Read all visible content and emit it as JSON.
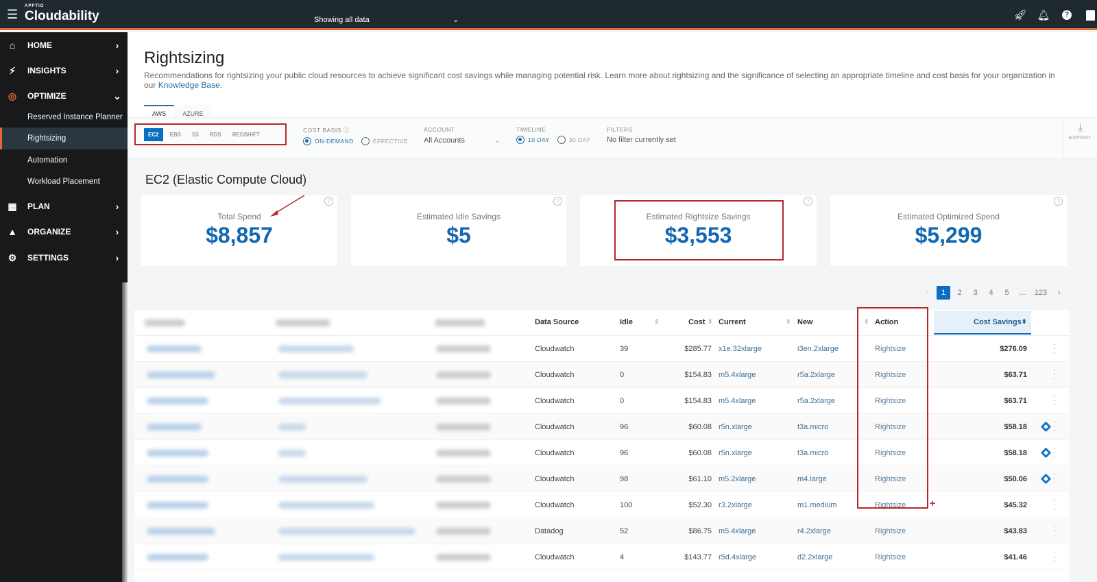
{
  "header": {
    "brand_small": "APPTIO",
    "brand": "Cloudability",
    "scope": "Showing all data",
    "icons": [
      "rocket-icon",
      "bell-icon",
      "help-icon",
      "user-icon"
    ]
  },
  "sidebar": {
    "items": [
      {
        "label": "HOME",
        "icon": "home-icon"
      },
      {
        "label": "INSIGHTS",
        "icon": "bolt-icon"
      },
      {
        "label": "OPTIMIZE",
        "icon": "target-icon",
        "expanded": true
      },
      {
        "label": "PLAN",
        "icon": "calendar-icon"
      },
      {
        "label": "ORGANIZE",
        "icon": "shapes-icon"
      },
      {
        "label": "SETTINGS",
        "icon": "gear-icon"
      }
    ],
    "sub_items": [
      {
        "label": "Reserved Instance Planner"
      },
      {
        "label": "Rightsizing",
        "active": true
      },
      {
        "label": "Automation"
      },
      {
        "label": "Workload Placement"
      }
    ]
  },
  "page": {
    "title": "Rightsizing",
    "description": "Recommendations for rightsizing your public cloud resources to achieve significant cost savings while managing potential risk. Learn more about rightsizing and the significance of selecting an appropriate timeline and cost basis for your organization in our ",
    "link": "Knowledge Base",
    "link_suffix": "."
  },
  "cloud_tabs": [
    "AWS",
    "AZURE"
  ],
  "service_tabs": [
    "EC2",
    "EBS",
    "S3",
    "RDS",
    "REDSHIFT"
  ],
  "filters": {
    "cost_basis_label": "COST BASIS",
    "cost_basis_options": [
      "ON-DEMAND",
      "EFFECTIVE"
    ],
    "account_label": "ACCOUNT",
    "account_value": "All Accounts",
    "timeline_label": "TIMELINE",
    "timeline_options": [
      "10 DAY",
      "30 DAY"
    ],
    "filters_label": "FILTERS",
    "filters_value": "No filter currently set",
    "export_label": "EXPORT"
  },
  "section_title": "EC2 (Elastic Compute Cloud)",
  "cards": [
    {
      "label": "Total Spend",
      "value": "$8,857"
    },
    {
      "label": "Estimated Idle Savings",
      "value": "$5"
    },
    {
      "label": "Estimated Rightsize Savings",
      "value": "$3,553"
    },
    {
      "label": "Estimated Optimized Spend",
      "value": "$5,299"
    }
  ],
  "pagination": {
    "prev": "‹",
    "pages": [
      "1",
      "2",
      "3",
      "4",
      "5",
      "…",
      "123"
    ],
    "next": "›",
    "current": "1"
  },
  "table": {
    "headers": {
      "data_source": "Data Source",
      "idle": "Idle",
      "cost": "Cost",
      "current": "Current",
      "new": "New",
      "action": "Action",
      "cost_savings": "Cost Savings"
    },
    "rows": [
      {
        "source": "Cloudwatch",
        "idle": "39",
        "cost": "$285.77",
        "current": "x1e.32xlarge",
        "new": "i3en.2xlarge",
        "action": "Rightsize",
        "savings": "$276.09",
        "flag": false
      },
      {
        "source": "Cloudwatch",
        "idle": "0",
        "cost": "$154.83",
        "current": "m5.4xlarge",
        "new": "r5a.2xlarge",
        "action": "Rightsize",
        "savings": "$63.71",
        "flag": false
      },
      {
        "source": "Cloudwatch",
        "idle": "0",
        "cost": "$154.83",
        "current": "m5.4xlarge",
        "new": "r5a.2xlarge",
        "action": "Rightsize",
        "savings": "$63.71",
        "flag": false
      },
      {
        "source": "Cloudwatch",
        "idle": "96",
        "cost": "$60.08",
        "current": "r5n.xlarge",
        "new": "t3a.micro",
        "action": "Rightsize",
        "savings": "$58.18",
        "flag": true
      },
      {
        "source": "Cloudwatch",
        "idle": "96",
        "cost": "$60.08",
        "current": "r5n.xlarge",
        "new": "t3a.micro",
        "action": "Rightsize",
        "savings": "$58.18",
        "flag": true
      },
      {
        "source": "Cloudwatch",
        "idle": "98",
        "cost": "$61.10",
        "current": "m5.2xlarge",
        "new": "m4.large",
        "action": "Rightsize",
        "savings": "$50.06",
        "flag": true
      },
      {
        "source": "Cloudwatch",
        "idle": "100",
        "cost": "$52.30",
        "current": "r3.2xlarge",
        "new": "m1.medium",
        "action": "Rightsize",
        "savings": "$45.32",
        "flag": false
      },
      {
        "source": "Datadog",
        "idle": "52",
        "cost": "$86.75",
        "current": "m5.4xlarge",
        "new": "r4.2xlarge",
        "action": "Rightsize",
        "savings": "$43.83",
        "flag": false
      },
      {
        "source": "Cloudwatch",
        "idle": "4",
        "cost": "$143.77",
        "current": "r5d.4xlarge",
        "new": "d2.2xlarge",
        "action": "Rightsize",
        "savings": "$41.46",
        "flag": false
      }
    ]
  },
  "colors": {
    "accent": "#0a6fc2",
    "brand_orange": "#e0683a",
    "annotation_red": "#b3282d",
    "value_blue": "#1268b3"
  }
}
